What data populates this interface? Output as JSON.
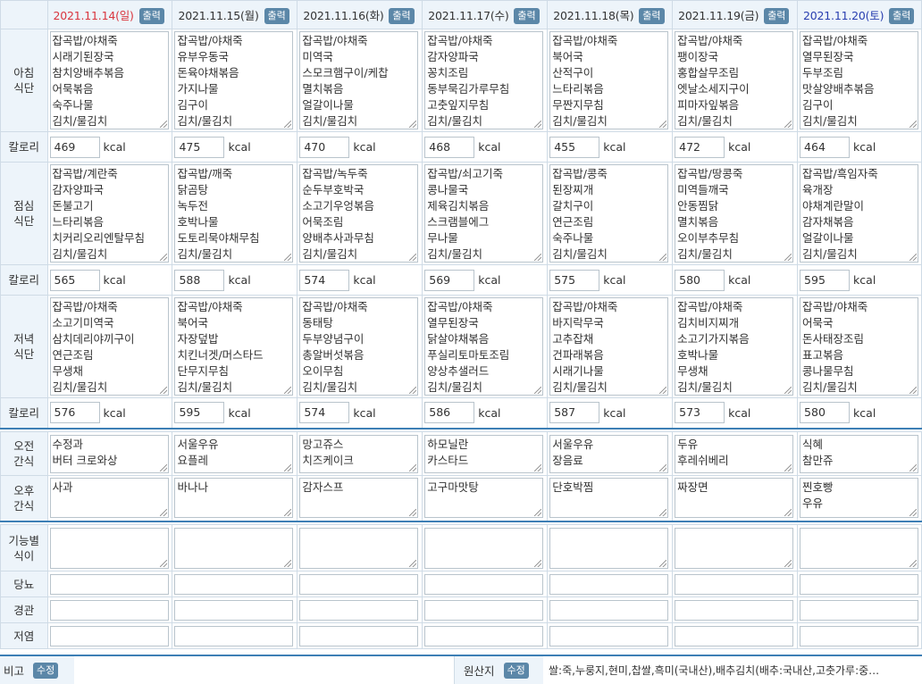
{
  "print_label": "출력",
  "kcal_unit": "kcal",
  "edit_label": "수정",
  "labels": {
    "breakfast": "아침 식단",
    "lunch": "점심 식단",
    "dinner": "저녁 식단",
    "calorie": "칼로리",
    "am_snack": "오전 간식",
    "pm_snack": "오후 간식",
    "functional": "기능별 식이",
    "diabetes": "당뇨",
    "tube": "경관",
    "low_salt": "저염",
    "remarks": "비고",
    "origin": "원산지"
  },
  "origin_text": "쌀:죽,누룽지,현미,찹쌀,흑미(국내산),배추김치(배추:국내산,고춧가루:중…",
  "days": [
    {
      "date": "2021.11.14(일)",
      "type": "sun",
      "breakfast": "잡곡밥/야채죽\n시래기된장국\n참치양배추볶음\n어묵볶음\n숙주나물\n김치/물김치",
      "breakfast_kcal": "469",
      "lunch": "잡곡밥/계란죽\n감자양파국\n돈불고기\n느타리볶음\n치커리오리엔탈무침\n김치/물김치",
      "lunch_kcal": "565",
      "dinner": "잡곡밥/야채죽\n소고기미역국\n삼치데리야끼구이\n연근조림\n무생채\n김치/물김치",
      "dinner_kcal": "576",
      "am_snack": "수정과\n버터 크로와상",
      "pm_snack": "사과"
    },
    {
      "date": "2021.11.15(월)",
      "type": "",
      "breakfast": "잡곡밥/야채죽\n유부우동국\n돈육야채볶음\n가지나물\n김구이\n김치/물김치",
      "breakfast_kcal": "475",
      "lunch": "잡곡밥/깨죽\n닭곰탕\n녹두전\n호박나물\n도토리묵야채무침\n김치/물김치",
      "lunch_kcal": "588",
      "dinner": "잡곡밥/야채죽\n북어국\n자장덮밥\n치킨너겟/머스타드\n단무지무침\n김치/물김치",
      "dinner_kcal": "595",
      "am_snack": "서울우유\n요플레",
      "pm_snack": "바나나"
    },
    {
      "date": "2021.11.16(화)",
      "type": "",
      "breakfast": "잡곡밥/야채죽\n미역국\n스모크햄구이/케찹\n멸치볶음\n얼갈이나물\n김치/물김치",
      "breakfast_kcal": "470",
      "lunch": "잡곡밥/녹두죽\n순두부호박국\n소고기우엉볶음\n어묵조림\n양배추사과무침\n김치/물김치",
      "lunch_kcal": "574",
      "dinner": "잡곡밥/야채죽\n동태탕\n두부양념구이\n총알버섯볶음\n오이무침\n김치/물김치",
      "dinner_kcal": "574",
      "am_snack": "망고쥬스\n치즈케이크",
      "pm_snack": "감자스프"
    },
    {
      "date": "2021.11.17(수)",
      "type": "",
      "breakfast": "잡곡밥/야채죽\n감자양파국\n꽁치조림\n동부묵김가루무침\n고춧잎지무침\n김치/물김치",
      "breakfast_kcal": "468",
      "lunch": "잡곡밥/쇠고기죽\n콩나물국\n제육김치볶음\n스크램블에그\n무나물\n김치/물김치",
      "lunch_kcal": "569",
      "dinner": "잡곡밥/야채죽\n열무된장국\n닭살야채볶음\n푸실리토마토조림\n양상추샐러드\n김치/물김치",
      "dinner_kcal": "586",
      "am_snack": "하모닐란\n카스타드",
      "pm_snack": "고구마맛탕"
    },
    {
      "date": "2021.11.18(목)",
      "type": "",
      "breakfast": "잡곡밥/야채죽\n북어국\n산적구이\n느타리볶음\n무짠지무침\n김치/물김치",
      "breakfast_kcal": "455",
      "lunch": "잡곡밥/콩죽\n된장찌개\n갈치구이\n연근조림\n숙주나물\n김치/물김치",
      "lunch_kcal": "575",
      "dinner": "잡곡밥/야채죽\n바지락무국\n고추잡채\n건파래볶음\n시래기나물\n김치/물김치",
      "dinner_kcal": "587",
      "am_snack": "서울우유\n장음료",
      "pm_snack": "단호박찜"
    },
    {
      "date": "2021.11.19(금)",
      "type": "",
      "breakfast": "잡곡밥/야채죽\n팽이장국\n홍합살무조림\n엣날소세지구이\n피마자잎볶음\n김치/물김치",
      "breakfast_kcal": "472",
      "lunch": "잡곡밥/땅콩죽\n미역들깨국\n안동찜닭\n멸치볶음\n오이부추무침\n김치/물김치",
      "lunch_kcal": "580",
      "dinner": "잡곡밥/야채죽\n김치비지찌개\n소고기가지볶음\n호박나물\n무생채\n김치/물김치",
      "dinner_kcal": "573",
      "am_snack": "두유\n후레쉬베리",
      "pm_snack": "짜장면"
    },
    {
      "date": "2021.11.20(토)",
      "type": "sat",
      "breakfast": "잡곡밥/야채죽\n열무된장국\n두부조림\n맛살양배추볶음\n김구이\n김치/물김치",
      "breakfast_kcal": "464",
      "lunch": "잡곡밥/흑임자죽\n육개장\n야채계란말이\n감자채볶음\n얼갈이나물\n김치/물김치",
      "lunch_kcal": "595",
      "dinner": "잡곡밥/야채죽\n어묵국\n돈사태장조림\n표고볶음\n콩나물무침\n김치/물김치",
      "dinner_kcal": "580",
      "am_snack": "식혜\n참만쥬",
      "pm_snack": "찐호빵\n우유"
    }
  ]
}
